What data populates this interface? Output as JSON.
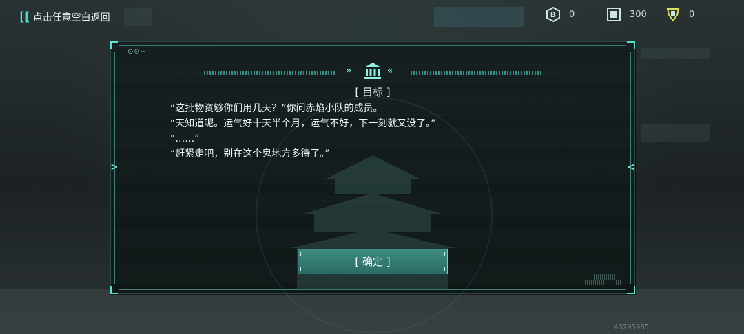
{
  "topbar": {
    "back_label": "点击任意空白返回",
    "currencies": [
      {
        "icon": "b-coin-icon",
        "value": "0"
      },
      {
        "icon": "material-chip-icon",
        "value": "300"
      },
      {
        "icon": "ticket-icon",
        "value": "0"
      }
    ]
  },
  "dialog": {
    "title": "[ 目标 ]",
    "lines": [
      "“这批物资够你们用几天？”你问赤焰小队的成员。",
      "“天知道呢。运气好十天半个月，运气不好，下一刻就又没了。”",
      "“……”",
      "“赶紧走吧，别在这个鬼地方多待了。”"
    ],
    "confirm_label": "[ 确定 ]",
    "header_icon": "bank-icon"
  },
  "footer": {
    "uid": "43295985"
  },
  "colors": {
    "accent": "#52e1cf",
    "button": "#2f7870"
  }
}
